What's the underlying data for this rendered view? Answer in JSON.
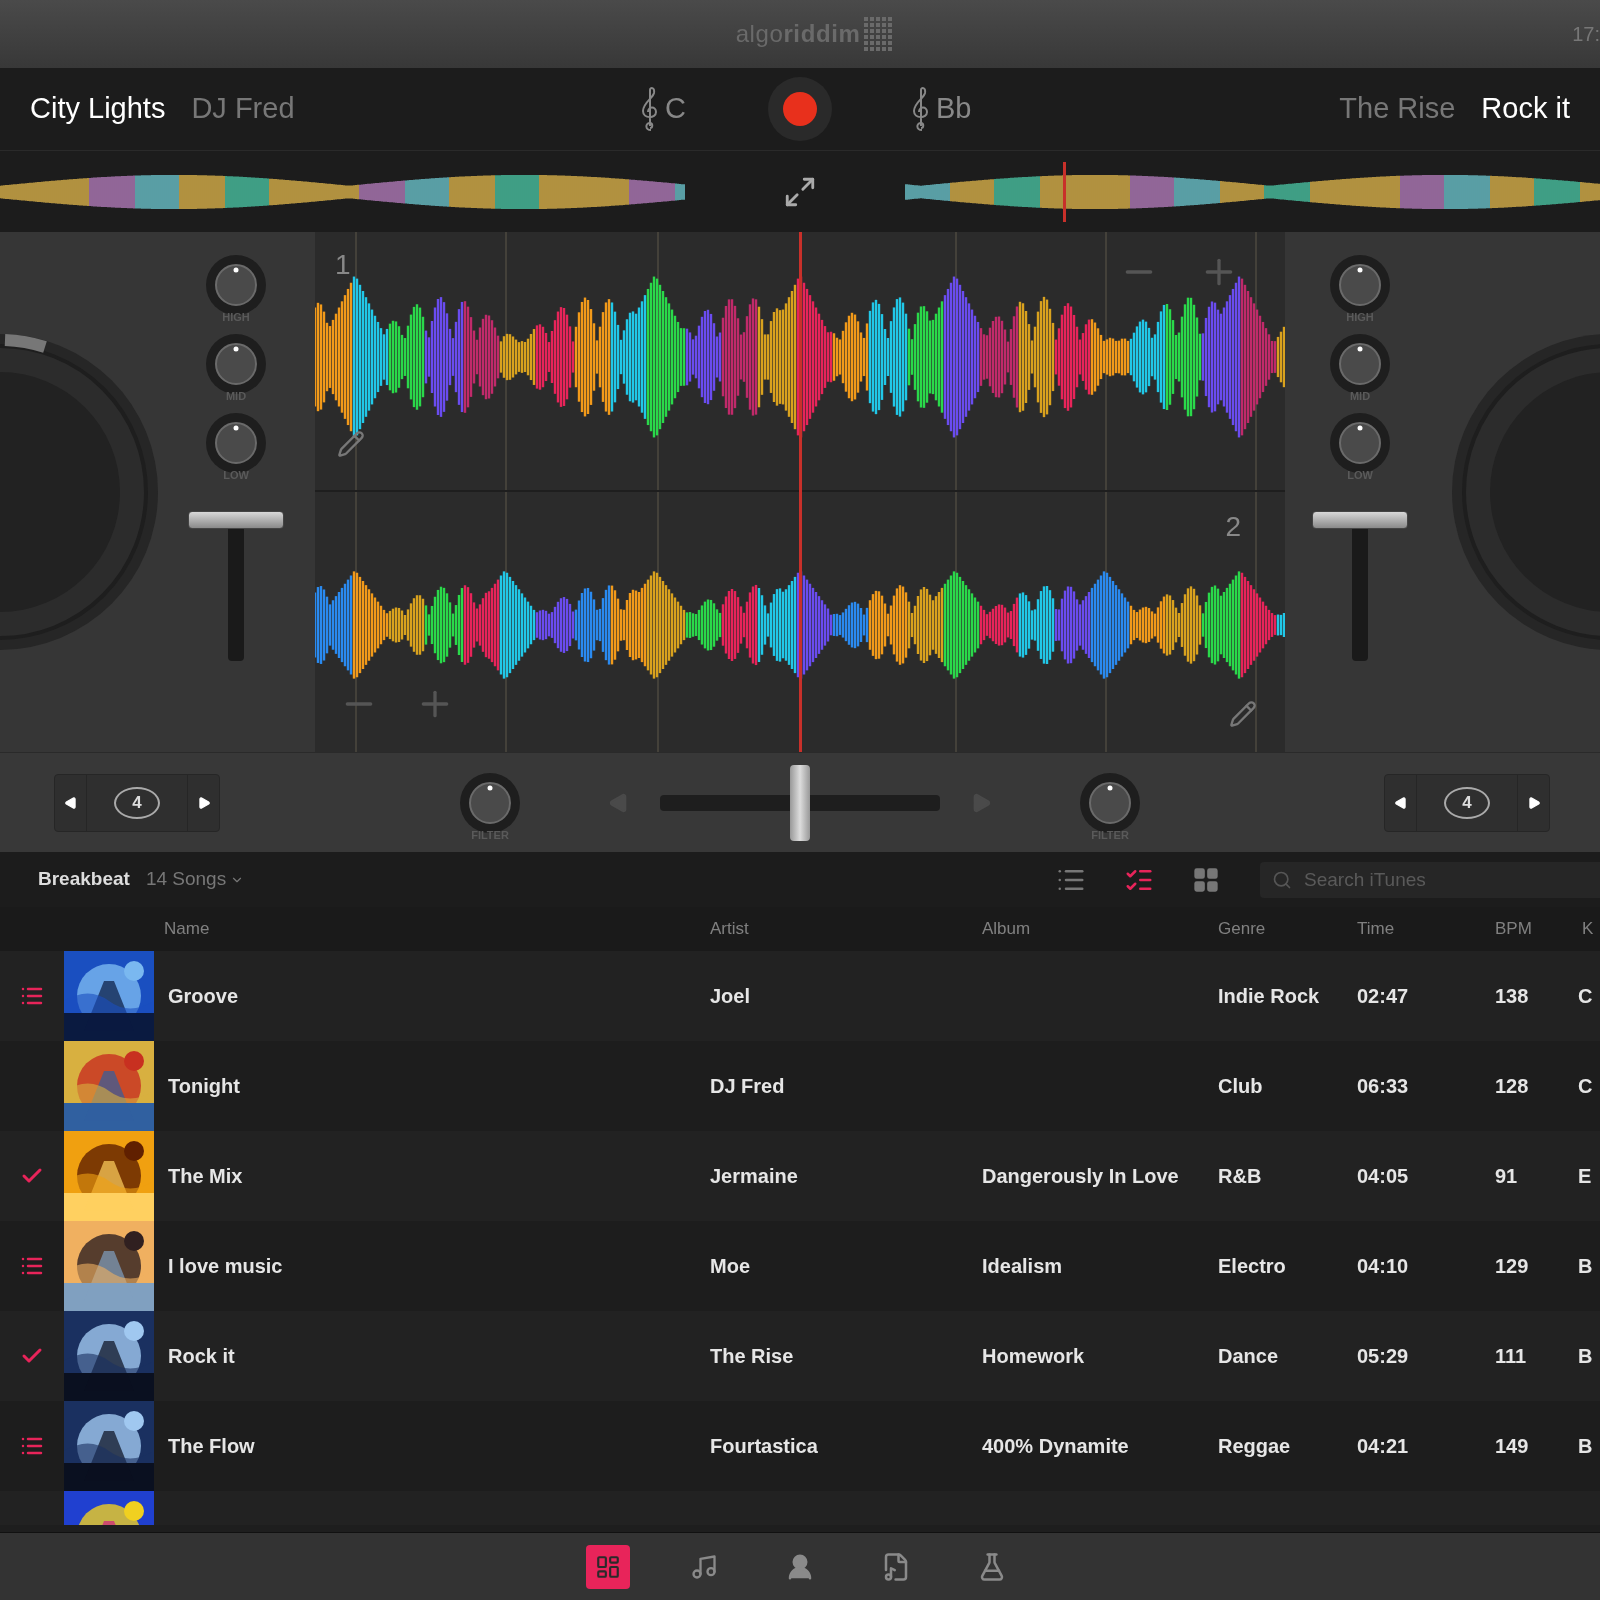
{
  "top_bar": {
    "logo": "algo**riddim**",
    "clock": "17:"
  },
  "deck_left": {
    "title": "City Lights",
    "artist": "DJ Fred",
    "key": "C",
    "track_number": "1",
    "knobs": [
      "HIGH",
      "MID",
      "LOW"
    ],
    "fader": {
      "level": 1
    },
    "loop": {
      "value": "4"
    },
    "filter": {
      "label": "FILTER"
    }
  },
  "record": {
    "kind": "record"
  },
  "deck_right": {
    "key": "Bb",
    "artist": "The Rise",
    "title": "Rock it",
    "track_number": "2",
    "knobs": [
      "HIGH",
      "MID",
      "LOW"
    ],
    "fader": {
      "level": 1
    },
    "loop": {
      "value": "4"
    },
    "filter": {
      "label": "FILTER"
    }
  },
  "crossfader": {
    "level": 0.5
  },
  "library": {
    "playlist": "Breakbeat",
    "count": "14 Songs",
    "views": [
      {
        "kind": "list",
        "selected": false
      },
      {
        "kind": "detail",
        "selected": true
      },
      {
        "kind": "grid",
        "selected": false
      }
    ],
    "search": {
      "placeholder": "Search iTunes"
    },
    "columns": [
      "Name",
      "Artist",
      "Album",
      "Genre",
      "Time",
      "BPM",
      "K"
    ],
    "rows": [
      {
        "kind": "queued",
        "name": "Groove",
        "artist": "Joel",
        "album": "",
        "genre": "Indie Rock",
        "time": "02:47",
        "bpm": "138",
        "key": "C"
      },
      {
        "kind": "none",
        "name": "Tonight",
        "artist": "DJ Fred",
        "album": "",
        "genre": "Club",
        "time": "06:33",
        "bpm": "128",
        "key": "C"
      },
      {
        "kind": "played",
        "name": "The Mix",
        "artist": "Jermaine",
        "album": "Dangerously In Love",
        "genre": "R&B",
        "time": "04:05",
        "bpm": "91",
        "key": "E"
      },
      {
        "kind": "queued",
        "name": "I love music",
        "artist": "Moe",
        "album": "Idealism",
        "genre": "Electro",
        "time": "04:10",
        "bpm": "129",
        "key": "B"
      },
      {
        "kind": "played",
        "name": "Rock it",
        "artist": "The Rise",
        "album": "Homework",
        "genre": "Dance",
        "time": "05:29",
        "bpm": "111",
        "key": "B"
      },
      {
        "kind": "queued",
        "name": "The Flow",
        "artist": "Fourtastica",
        "album": "400% Dynamite",
        "genre": "Reggae",
        "time": "04:21",
        "bpm": "149",
        "key": "B"
      }
    ]
  },
  "bottom_tabs": [
    {
      "kind": "mixer",
      "selected": true
    },
    {
      "kind": "note",
      "selected": false
    },
    {
      "kind": "person",
      "selected": false
    },
    {
      "kind": "file",
      "selected": false
    },
    {
      "kind": "flasks",
      "selected": false
    }
  ]
}
